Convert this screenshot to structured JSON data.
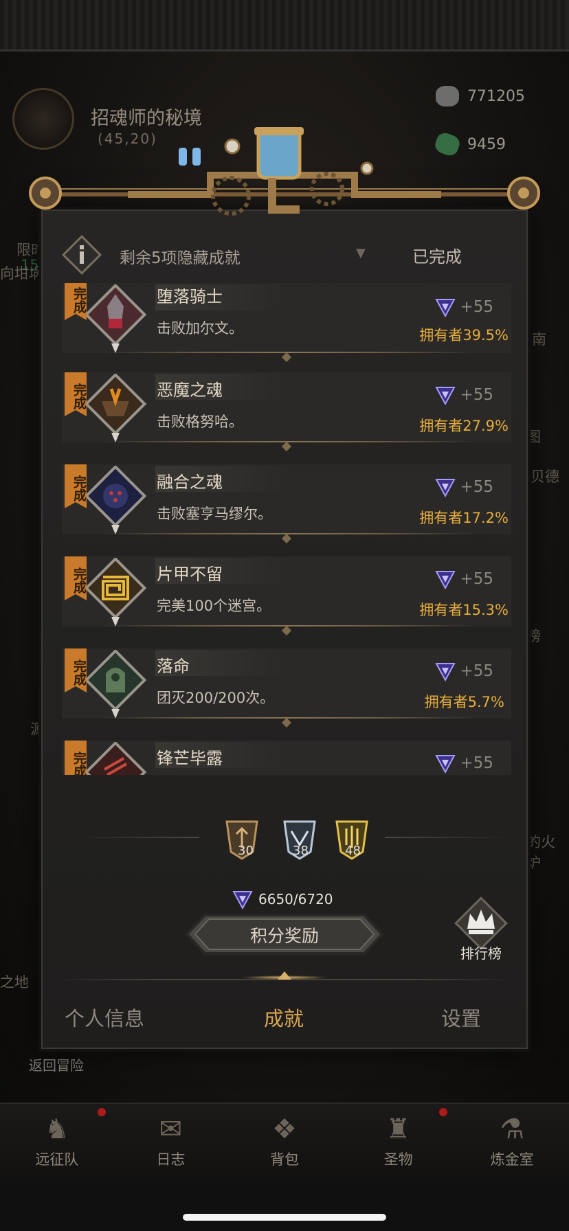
{
  "background": {
    "location": {
      "name": "招魂师的秘境",
      "coords": "(45,20)"
    },
    "resources": [
      {
        "icon": "stone-ore-icon",
        "value": "771205"
      },
      {
        "icon": "green-gem-icon",
        "value": "9459"
      }
    ],
    "side_fragments": {
      "limited": "限时",
      "num": "15",
      "left1": "向坩埚",
      "left2": "源",
      "left3": "之地",
      "right1": "南",
      "right2": "图",
      "right3": "贝德",
      "right4": "榜",
      "right5": "的火炉"
    },
    "back_to_adventure": "返回冒险"
  },
  "modal": {
    "info_bar": {
      "text": "剩余5项隐藏成就",
      "status": "已完成"
    },
    "done_tag": "完成",
    "achievements": [
      {
        "title": "堕落骑士",
        "desc": "击败加尔文。",
        "points": "+55",
        "owners": "拥有者39.5%",
        "art": "fallen-knight-icon"
      },
      {
        "title": "恶魔之魂",
        "desc": "击败格努哈。",
        "points": "+55",
        "owners": "拥有者27.9%",
        "art": "demon-soul-icon"
      },
      {
        "title": "融合之魂",
        "desc": "击败塞亨马缪尔。",
        "points": "+55",
        "owners": "拥有者17.2%",
        "art": "fused-soul-icon"
      },
      {
        "title": "片甲不留",
        "desc": "完美100个迷宫。",
        "points": "+55",
        "owners": "拥有者15.3%",
        "art": "maze-icon"
      },
      {
        "title": "落命",
        "desc": "团灭200/200次。",
        "points": "+55",
        "owners": "拥有者5.7%",
        "art": "doom-icon"
      },
      {
        "title": "锋芒毕露",
        "desc": "",
        "points": "+55",
        "owners": "",
        "art": "blade-icon"
      }
    ],
    "tiers": [
      {
        "name": "bronze-tier-icon",
        "count": "30",
        "color": "#b9915a"
      },
      {
        "name": "silver-tier-icon",
        "count": "38",
        "color": "#b9c8d8"
      },
      {
        "name": "gold-tier-icon",
        "count": "48",
        "color": "#e3c04a"
      }
    ],
    "score": "6650/6720",
    "reward_button": "积分奖励",
    "ranking_button": "排行榜",
    "tabs": [
      {
        "label": "个人信息",
        "active": false
      },
      {
        "label": "成就",
        "active": true
      },
      {
        "label": "设置",
        "active": false
      }
    ]
  },
  "bottom_nav": [
    {
      "label": "远征队",
      "icon": "horned-helmet-icon",
      "badge": true
    },
    {
      "label": "日志",
      "icon": "journal-icon",
      "badge": false
    },
    {
      "label": "背包",
      "icon": "backpack-icon",
      "badge": false
    },
    {
      "label": "圣物",
      "icon": "relic-icon",
      "badge": true
    },
    {
      "label": "炼金室",
      "icon": "alchemy-icon",
      "badge": false
    }
  ],
  "colors": {
    "accent": "#d9a653",
    "owner_text": "#e6ad3a",
    "done_tag": "#c97a2a",
    "badge_red": "#b01a1a"
  }
}
